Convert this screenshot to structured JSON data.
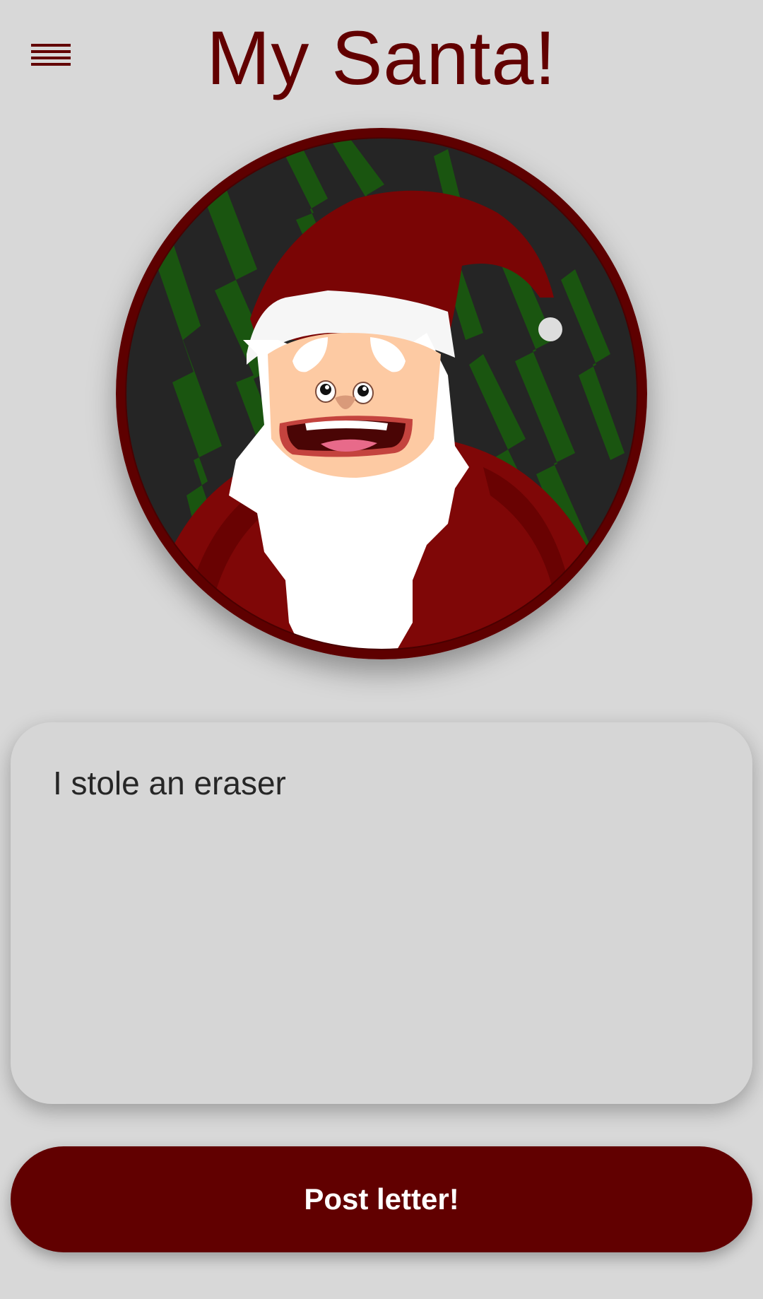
{
  "header": {
    "title": "My Santa!",
    "menu_icon": "hamburger-menu-icon"
  },
  "avatar": {
    "icon": "santa-avatar-icon"
  },
  "letter": {
    "value": "I stole an eraser",
    "placeholder": ""
  },
  "actions": {
    "post_label": "Post letter!"
  },
  "colors": {
    "background": "#d8d8d8",
    "brand": "#620000",
    "card": "#d6d6d6"
  }
}
